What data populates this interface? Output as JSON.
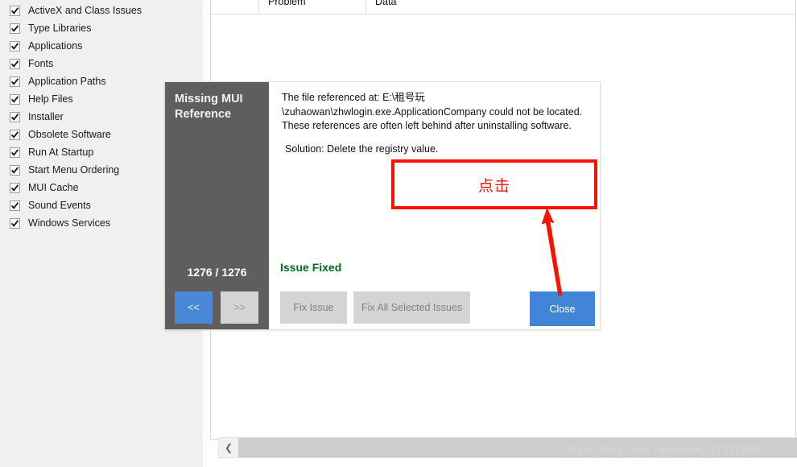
{
  "left_panel": {
    "name": "scan-categories",
    "items": [
      {
        "label": "ActiveX and Class Issues",
        "checked": true
      },
      {
        "label": "Type Libraries",
        "checked": true
      },
      {
        "label": "Applications",
        "checked": true
      },
      {
        "label": "Fonts",
        "checked": true
      },
      {
        "label": "Application Paths",
        "checked": true
      },
      {
        "label": "Help Files",
        "checked": true
      },
      {
        "label": "Installer",
        "checked": true
      },
      {
        "label": "Obsolete Software",
        "checked": true
      },
      {
        "label": "Run At Startup",
        "checked": true
      },
      {
        "label": "Start Menu Ordering",
        "checked": true
      },
      {
        "label": "MUI Cache",
        "checked": true
      },
      {
        "label": "Sound Events",
        "checked": true
      },
      {
        "label": "Windows Services",
        "checked": true
      }
    ]
  },
  "grid": {
    "headers": {
      "select_all": "",
      "problem": "Problem",
      "data": "Data"
    }
  },
  "scrollbar": {
    "left_arrow": "❮"
  },
  "dialog": {
    "title": "Missing MUI Reference",
    "counter": "1276 / 1276",
    "nav_prev": "<<",
    "nav_next": ">>",
    "description": "The file referenced at: E:\\租号玩\\zuhaowan\\zhwlogin.exe.ApplicationCompany could not be located. These references are often left behind after uninstalling software.",
    "solution": "Solution: Delete the registry value.",
    "status": "Issue Fixed",
    "fix_issue_label": "Fix Issue",
    "fix_all_label": "Fix All Selected Issues",
    "close_label": "Close"
  },
  "annotation": {
    "box_text": "点击",
    "arrow_color": "#fb1100",
    "box_color": "#fb1100"
  },
  "watermark": {
    "text": "https://blog.csdn.net/weixin_47397805"
  },
  "colors": {
    "sidebar_dark": "#5e5e5e",
    "primary_blue": "#4285d6",
    "disabled_gray": "#d4d4d4",
    "status_green": "#006b1e",
    "annotation_red": "#fb1100",
    "panel_bg": "#f0f0f0"
  }
}
